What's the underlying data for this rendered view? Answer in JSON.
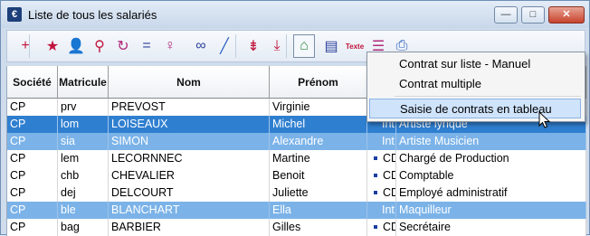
{
  "window": {
    "title": "Liste de tous les salariés",
    "app_icon": "€"
  },
  "controls": {
    "minimize": "—",
    "maximize": "□",
    "close": "✕"
  },
  "toolbar": [
    {
      "icon": "plus-icon",
      "glyph": "+",
      "color": "#c0143c"
    },
    {
      "icon": "star-list-icon",
      "glyph": "★",
      "color": "#c0143c"
    },
    {
      "icon": "user-add-icon",
      "glyph": "👤",
      "color": "#c0143c"
    },
    {
      "icon": "user-key-icon",
      "glyph": "⚲",
      "color": "#c0143c"
    },
    {
      "icon": "refresh-icon",
      "glyph": "↻",
      "color": "#b02a7a"
    },
    {
      "icon": "equal-icon",
      "glyph": "=",
      "color": "#2a3f9a"
    },
    {
      "icon": "key-icon",
      "glyph": "♀",
      "color": "#b02a7a"
    },
    {
      "icon": "glasses-icon",
      "glyph": "∞",
      "color": "#2a3f9a"
    },
    {
      "icon": "pen-icon",
      "glyph": "╱",
      "color": "#2a5fc0"
    },
    {
      "icon": "sort-asc-icon",
      "glyph": "⇟",
      "color": "#c0143c"
    },
    {
      "icon": "sort-down-icon",
      "glyph": "⤓",
      "color": "#c0143c"
    },
    {
      "icon": "house-add-icon",
      "glyph": "⌂",
      "color": "#2e8b3a"
    },
    {
      "icon": "document-add-icon",
      "glyph": "▤",
      "color": "#2a3f9a"
    },
    {
      "icon": "text-icon",
      "glyph": "Texte",
      "color": "#c0143c"
    },
    {
      "icon": "list-icon",
      "glyph": "☰",
      "color": "#b02a7a"
    },
    {
      "icon": "printer-icon",
      "glyph": "⎙",
      "color": "#2a5fc0"
    }
  ],
  "columns": [
    "Société",
    "Matricule",
    "Nom",
    "Prénom",
    "",
    ""
  ],
  "rows": [
    {
      "societe": "CP",
      "matricule": "prv",
      "nom": "PREVOST",
      "prenom": "Virginie",
      "contrat": "",
      "poste": "",
      "state": "normal"
    },
    {
      "societe": "CP",
      "matricule": "lom",
      "nom": "LOISEAUX",
      "prenom": "Michel",
      "contrat": "Int.",
      "poste": "Artiste lyrique",
      "state": "selected"
    },
    {
      "societe": "CP",
      "matricule": "sia",
      "nom": "SIMON",
      "prenom": "Alexandre",
      "contrat": "Int.",
      "poste": "Artiste Musicien",
      "state": "highlight"
    },
    {
      "societe": "CP",
      "matricule": "lem",
      "nom": "LECORNNEC",
      "prenom": "Martine",
      "contrat": "CDI",
      "poste": "Chargé de Production",
      "state": "normal"
    },
    {
      "societe": "CP",
      "matricule": "chb",
      "nom": "CHEVALIER",
      "prenom": "Benoit",
      "contrat": "CDI",
      "poste": "Comptable",
      "state": "normal"
    },
    {
      "societe": "CP",
      "matricule": "dej",
      "nom": "DELCOURT",
      "prenom": "Juliette",
      "contrat": "CDI",
      "poste": "Employé administratif",
      "state": "normal"
    },
    {
      "societe": "CP",
      "matricule": "ble",
      "nom": "BLANCHART",
      "prenom": "Ella",
      "contrat": "Int.",
      "poste": "Maquilleur",
      "state": "highlight"
    },
    {
      "societe": "CP",
      "matricule": "bag",
      "nom": "BARBIER",
      "prenom": "Gilles",
      "contrat": "CDI",
      "poste": "Secrétaire",
      "state": "normal"
    }
  ],
  "menu": {
    "items": [
      {
        "label": "Contrat sur liste - Manuel"
      },
      {
        "label": "Contrat multiple"
      },
      {
        "label": "Saisie de contrats en tableau"
      }
    ]
  },
  "colors": {
    "selected": "#2f7fd0",
    "highlight": "#7bb3e8",
    "menu_hover": "#cfe3fb"
  }
}
